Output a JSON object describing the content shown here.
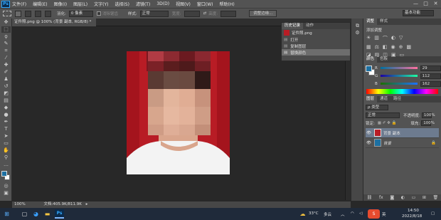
{
  "menu": {
    "logo": "Ps",
    "items": [
      "文件(F)",
      "编辑(E)",
      "图像(I)",
      "图层(L)",
      "文字(Y)",
      "选择(S)",
      "滤镜(T)",
      "3D(D)",
      "视图(V)",
      "窗口(W)",
      "帮助(H)"
    ],
    "win_min": "—",
    "win_max": "□",
    "win_close": "✕"
  },
  "options": {
    "feather_label": "羽化:",
    "feather_value": "0 像素",
    "antialias_label": "消除锯齿",
    "style_label": "样式:",
    "style_value": "正常",
    "width_label": "宽度:",
    "height_label": "高度:",
    "refine_edge_button": "调整边缘...",
    "workspace": "基本功能"
  },
  "document": {
    "tab_title": "证件照.png @ 100% (背景 副本, RGB/8) *",
    "zoom": "100%",
    "doc_size": "文档:405.9K/811.9K"
  },
  "history": {
    "tabs": [
      "历史记录",
      "动作"
    ],
    "snapshot_name": "证件照.png",
    "items": [
      "打开",
      "复制图层",
      "替换颜色"
    ]
  },
  "adjust_panel": {
    "tabs": [
      "调整",
      "样式"
    ],
    "add_label": "添加调整"
  },
  "color_panel": {
    "tabs": [
      "颜色",
      "色板"
    ],
    "r_label": "R",
    "g_label": "G",
    "b_label": "B",
    "r_value": "29",
    "g_value": "112",
    "b_value": "162",
    "foreground_color": "#1d70a2"
  },
  "layers": {
    "tabs": [
      "图层",
      "通道",
      "路径"
    ],
    "filter_kind": "ρ 类型",
    "blend_mode": "正常",
    "opacity_label": "不透明度:",
    "opacity_value": "100%",
    "lock_label": "锁定:",
    "fill_label": "填充:",
    "fill_value": "100%",
    "items": [
      "背景 副本",
      "背景"
    ]
  },
  "taskbar": {
    "weather_temp": "33°C",
    "weather_desc": "多云",
    "time": "14:50",
    "date": "2022/8/18",
    "ime": "英"
  }
}
